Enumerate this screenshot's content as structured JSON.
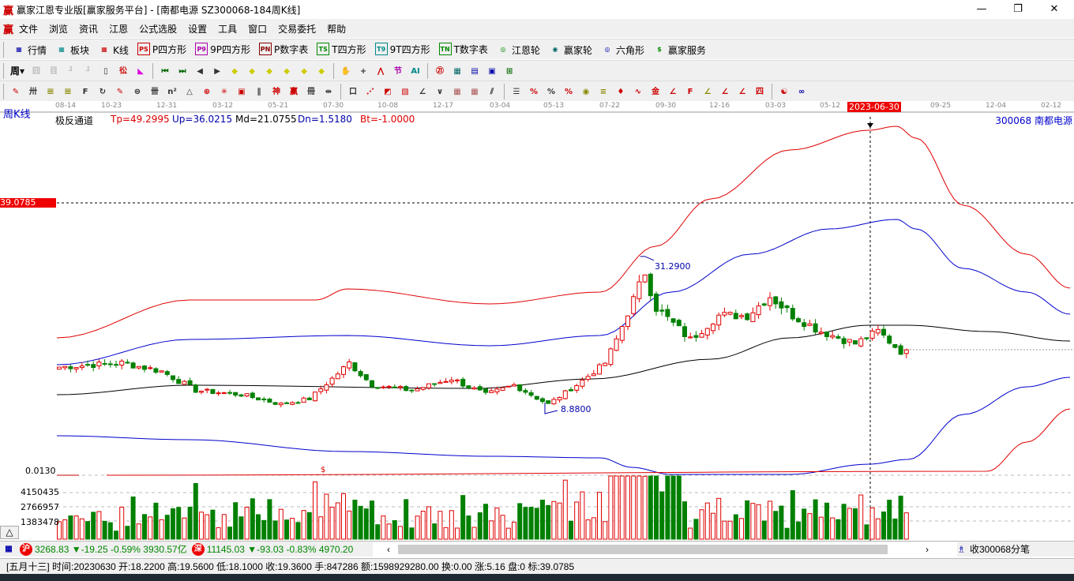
{
  "window": {
    "title": "赢家江恩专业版[赢家服务平台] - [南都电源  SZ300068-184周K线]",
    "logo": "赢",
    "min": "—",
    "max": "❐",
    "close": "✕"
  },
  "menu": {
    "logo": "赢",
    "items": [
      "文件",
      "浏览",
      "资讯",
      "江恩",
      "公式选股",
      "设置",
      "工具",
      "窗口",
      "交易委托",
      "帮助"
    ]
  },
  "toolbar1": [
    {
      "icon": "grid-icon",
      "label": "行情"
    },
    {
      "icon": "blocks-icon",
      "label": "板块"
    },
    {
      "icon": "candles-icon",
      "label": "K线"
    },
    {
      "icon": "ps-icon",
      "badge": "PS",
      "label": "P四方形"
    },
    {
      "icon": "p9-icon",
      "badge": "P9",
      "label": "9P四方形"
    },
    {
      "icon": "pn-icon",
      "badge": "PN",
      "label": "P数字表"
    },
    {
      "icon": "ts-icon",
      "badge": "TS",
      "label": "T四方形"
    },
    {
      "icon": "t9-icon",
      "badge": "T9",
      "label": "9T四方形"
    },
    {
      "icon": "tn-icon",
      "badge": "TN",
      "label": "T数字表"
    },
    {
      "icon": "target-icon",
      "badge": "◎",
      "label": "江恩轮"
    },
    {
      "icon": "wheel-icon",
      "badge": "◉",
      "label": "赢家轮"
    },
    {
      "icon": "hexagon-icon",
      "badge": "◎",
      "label": "六角形"
    },
    {
      "icon": "dollar-icon",
      "badge": "$",
      "label": "赢家服务"
    }
  ],
  "toolbar2": {
    "period": "周"
  },
  "chart": {
    "period_label": "周K线",
    "indicator": {
      "name": "极反通道",
      "tp": "Tp=49.2995",
      "up": "Up=36.0215",
      "md": "Md=21.0755",
      "dn": "Dn=1.5180",
      "bt": "Bt=-1.0000"
    },
    "stock": "300068  南都电源",
    "date_ticks": [
      "08-14",
      "10-23",
      "12-31",
      "03-12",
      "05-21",
      "07-30",
      "10-08",
      "12-17",
      "03-04",
      "05-13",
      "07-22",
      "09-30",
      "12-16",
      "03-03",
      "05-12",
      "09-25",
      "12-04",
      "02-12"
    ],
    "cursor_date": "2023-06-30",
    "cursor_price": "39.0785",
    "high_label": "31.2900",
    "low_label": "8.8800",
    "sub_label": "0.0130",
    "sub_marker": "$",
    "volume_ticks": [
      "4150435",
      "2766957",
      "1383478"
    ],
    "colors": {
      "up": "#e00000",
      "down": "#008000",
      "upper_band": "#e00000",
      "mid_band": "#0000cc",
      "center": "#000000"
    },
    "close_keypoints": [
      [
        0,
        15.2
      ],
      [
        11,
        15.8
      ],
      [
        18,
        14.6
      ],
      [
        24,
        11.8
      ],
      [
        32,
        11.2
      ],
      [
        39,
        9.8
      ],
      [
        44,
        10.6
      ],
      [
        48,
        13.5
      ],
      [
        51,
        15.8
      ],
      [
        55,
        12.6
      ],
      [
        62,
        11.8
      ],
      [
        69,
        13.5
      ],
      [
        75,
        11.2
      ],
      [
        80,
        12.6
      ],
      [
        86,
        9.8
      ],
      [
        91,
        12.6
      ],
      [
        96,
        15.8
      ],
      [
        98,
        19.2
      ],
      [
        101,
        25
      ],
      [
        103,
        29
      ],
      [
        105,
        23.8
      ],
      [
        108,
        21.5
      ],
      [
        111,
        19.2
      ],
      [
        116,
        22.7
      ],
      [
        121,
        22.7
      ],
      [
        125,
        25.5
      ],
      [
        129,
        22.7
      ],
      [
        134,
        20.4
      ],
      [
        140,
        18.6
      ],
      [
        144,
        20.4
      ],
      [
        148,
        17.5
      ],
      [
        149,
        17.3
      ]
    ]
  },
  "bottom": {
    "sh_badge": "沪",
    "sh": "3268.83 ▼-19.25 -0.59% 3930.57亿",
    "sz_badge": "深",
    "sz": "11145.03 ▼-93.03 -0.83% 4970.20",
    "left": "‹",
    "right": "›",
    "tick_label": "收300068分笔",
    "collapse": "△"
  },
  "status": "[五月十三] 时间:20230630 开:18.2200 高:19.5600 低:18.1000 收:19.3600 手:847286 额:1598929280.00 换:0.00 涨:5.16 盘:0 标:39.0785"
}
